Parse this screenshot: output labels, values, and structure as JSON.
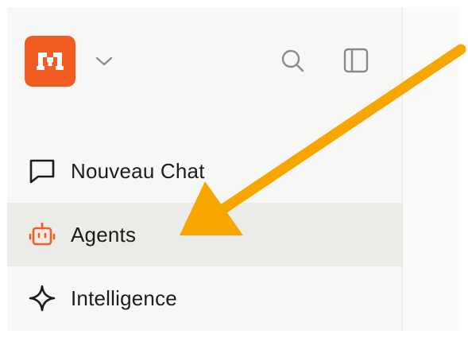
{
  "brand": {
    "color": "#f35c20",
    "logo_icon": "mistral-m-logo"
  },
  "header": {
    "workspace_menu_icon": "chevron-down-icon",
    "search_icon": "search-icon",
    "sidebar_toggle_icon": "sidebar-toggle-icon"
  },
  "sidebar": {
    "items": [
      {
        "label": "Nouveau Chat",
        "icon": "chat-bubble-icon",
        "active": false
      },
      {
        "label": "Agents",
        "icon": "robot-icon",
        "active": true,
        "icon_color": "#f35c20"
      },
      {
        "label": "Intelligence",
        "icon": "sparkle-icon",
        "active": false
      }
    ]
  },
  "annotation": {
    "type": "arrow",
    "color": "#f7a600",
    "points_to": "Agents"
  }
}
